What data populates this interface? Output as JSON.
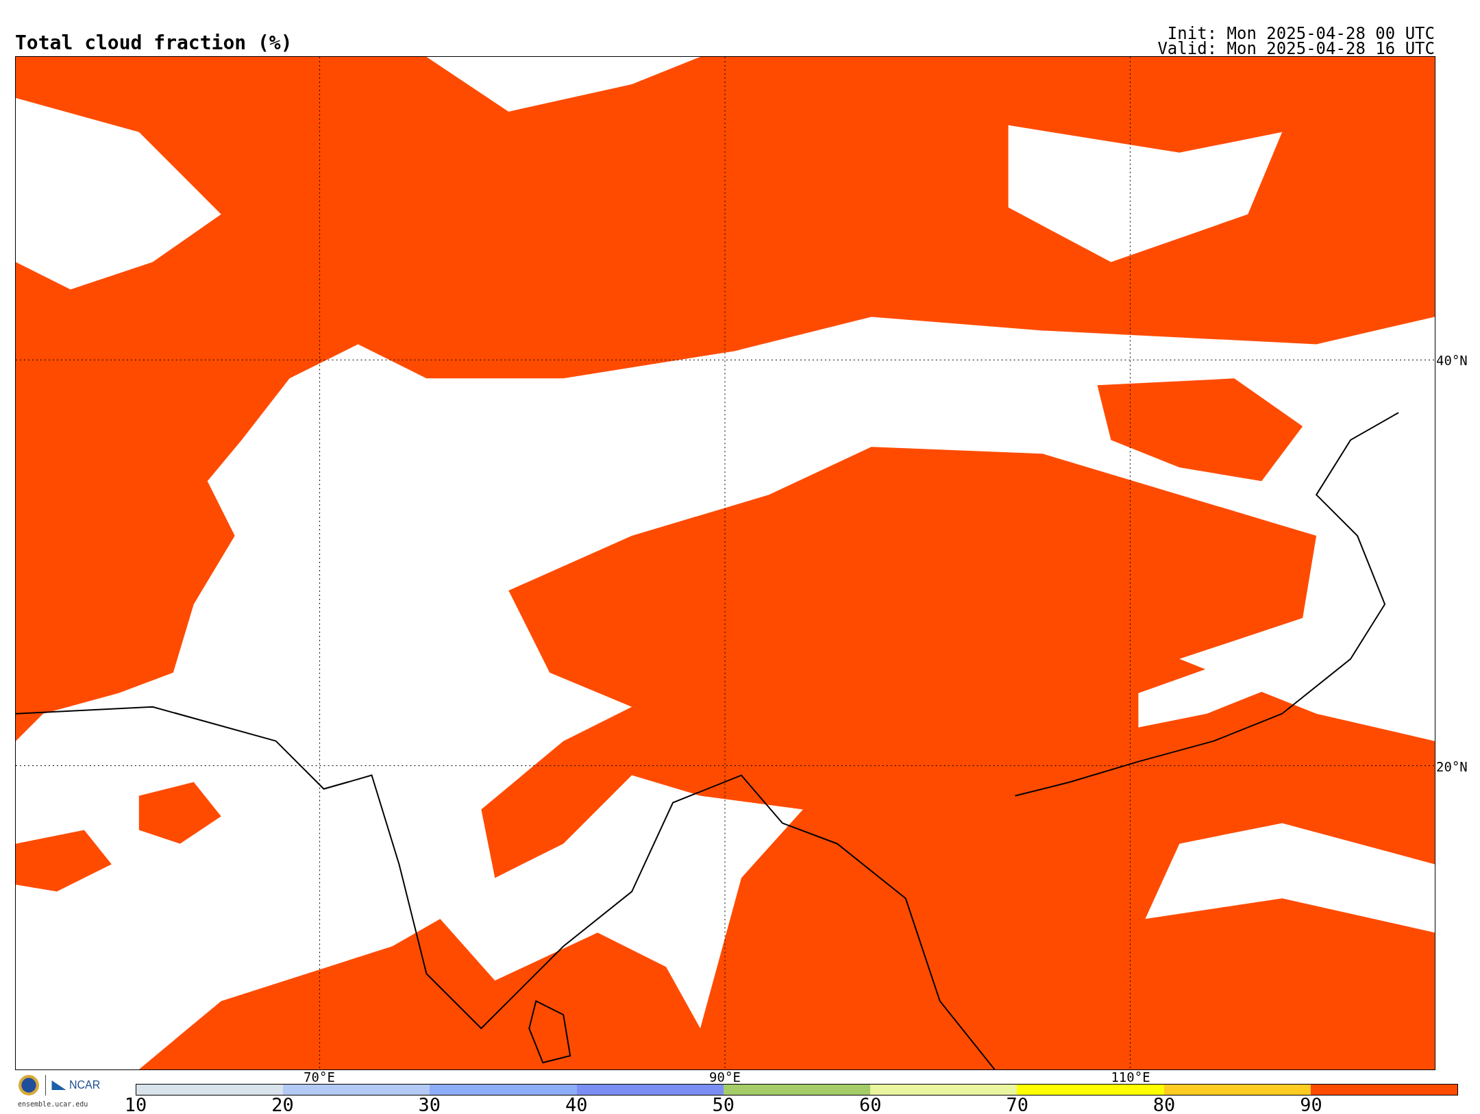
{
  "title": "Total cloud fraction (%)",
  "init": "Init: Mon 2025-04-28 00 UTC",
  "valid": "Valid: Mon 2025-04-28 16 UTC",
  "map": {
    "lat_labels": [
      "40°N",
      "20°N"
    ],
    "lon_labels": [
      "70°E",
      "90°E",
      "110°E"
    ]
  },
  "logo": {
    "name": "NCAR",
    "url": "ensemble.ucar.edu"
  },
  "colorbar": {
    "segments": [
      {
        "color": "#d9e3ec"
      },
      {
        "color": "#b3c9f6"
      },
      {
        "color": "#8eadf8"
      },
      {
        "color": "#7b8ef4"
      },
      {
        "color": "#a4cc68"
      },
      {
        "color": "#eaf5a0"
      },
      {
        "color": "#ffff00"
      },
      {
        "color": "#ffcc22"
      },
      {
        "color": "#ff4b00"
      }
    ],
    "tick_labels": [
      "10",
      "20",
      "30",
      "40",
      "50",
      "60",
      "70",
      "80",
      "90"
    ]
  }
}
